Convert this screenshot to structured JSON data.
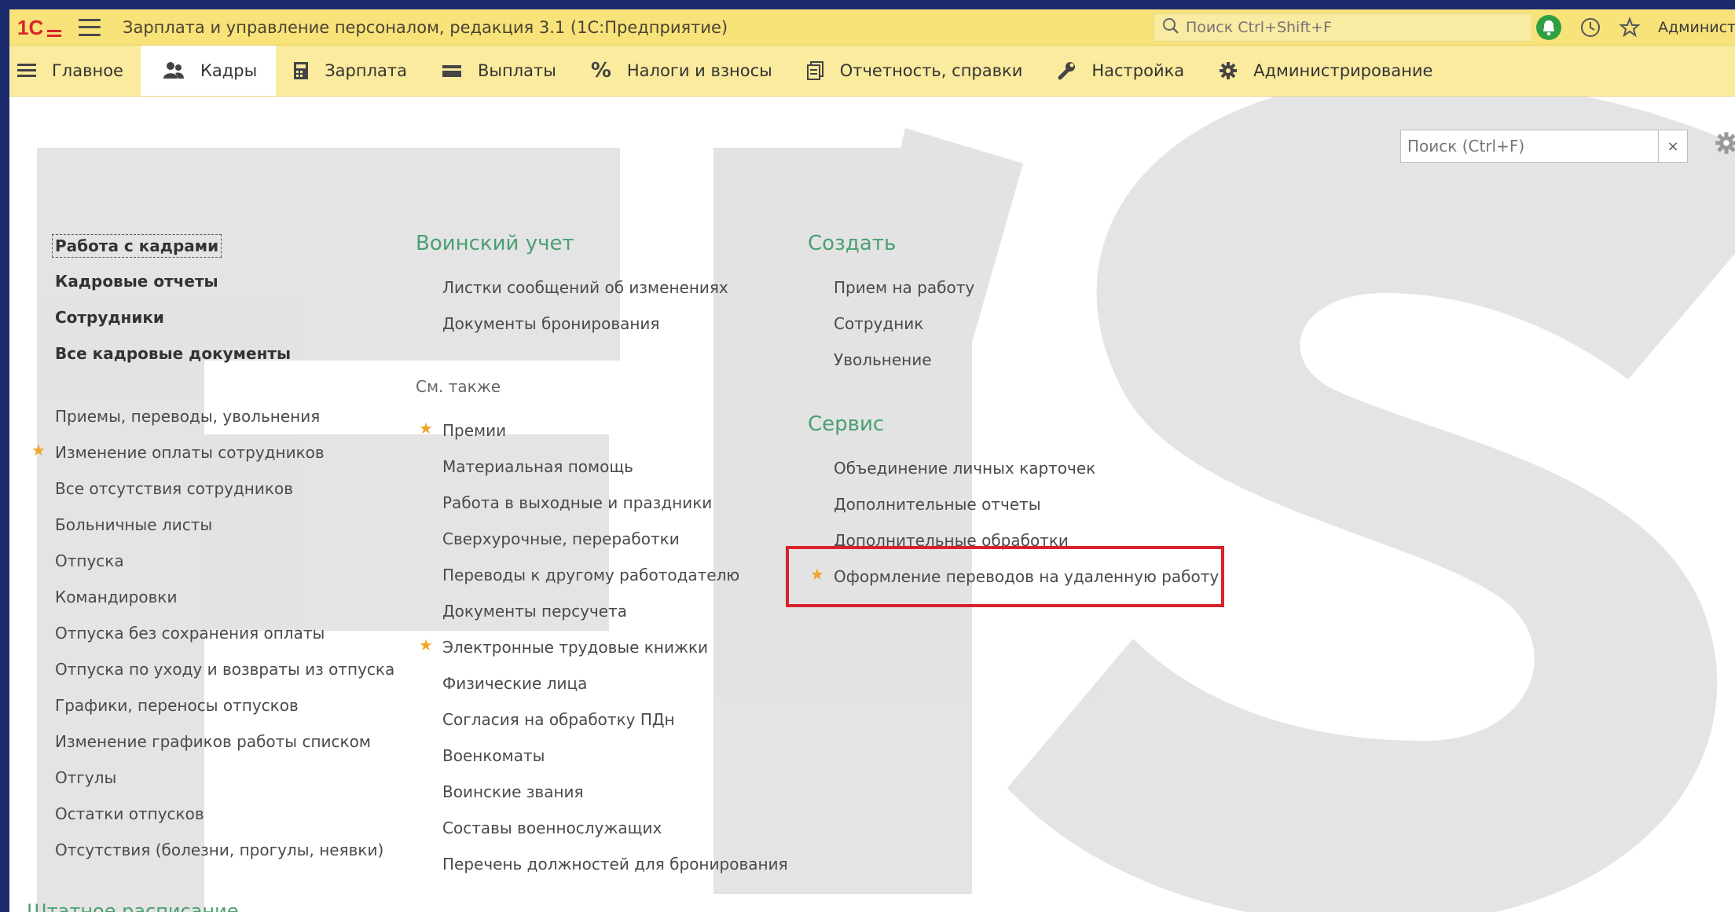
{
  "window": {
    "app_title": "Зарплата и управление персоналом, редакция 3.1  (1С:Предприятие)",
    "search_placeholder": "Поиск Ctrl+Shift+F",
    "user_name": "Админист"
  },
  "sections": [
    {
      "label": "Главное",
      "icon": "menu-icon"
    },
    {
      "label": "Кадры",
      "icon": "people-icon"
    },
    {
      "label": "Зарплата",
      "icon": "calculator-icon"
    },
    {
      "label": "Выплаты",
      "icon": "wallet-icon"
    },
    {
      "label": "Налоги и взносы",
      "icon": "percent-icon"
    },
    {
      "label": "Отчетность, справки",
      "icon": "report-icon"
    },
    {
      "label": "Настройка",
      "icon": "wrench-icon"
    },
    {
      "label": "Администрирование",
      "icon": "gear-icon"
    }
  ],
  "active_section": "Кадры",
  "local_search": {
    "placeholder": "Поиск (Ctrl+F)",
    "clear": "×"
  },
  "col1": {
    "bold_items": [
      "Работа с кадрами",
      "Кадровые отчеты",
      "Сотрудники",
      "Все кадровые документы"
    ],
    "items": [
      "Приемы, переводы, увольнения",
      "Изменение оплаты сотрудников",
      "Все отсутствия сотрудников",
      "Больничные листы",
      "Отпуска",
      "Командировки",
      "Отпуска без сохранения оплаты",
      "Отпуска по уходу и возвраты из отпуска",
      "Графики, переносы отпусков",
      "Изменение графиков работы списком",
      "Отгулы",
      "Остатки отпусков",
      "Отсутствия (болезни, прогулы, неявки)"
    ]
  },
  "col2": {
    "header": "Воинский учет",
    "group1": [
      "Листки сообщений об изменениях",
      "Документы бронирования"
    ],
    "see_also": "См. также",
    "group2": [
      "Премии",
      "Материальная помощь",
      "Работа в выходные и праздники",
      "Сверхурочные, переработки",
      "Переводы к другому работодателю",
      "Документы персучета",
      "Электронные трудовые книжки",
      "Физические лица",
      "Согласия на обработку ПДн",
      "Военкоматы",
      "Воинские звания",
      "Составы военнослужащих",
      "Перечень должностей для бронирования"
    ]
  },
  "col3": {
    "create_header": "Создать",
    "create_items": [
      "Прием на работу",
      "Сотрудник",
      "Увольнение"
    ],
    "service_header": "Сервис",
    "service_items": [
      "Объединение личных карточек",
      "Дополнительные отчеты",
      "Дополнительные обработки",
      "Оформление переводов на удаленную работу"
    ]
  },
  "footer_link": "Штатное расписание",
  "colors": {
    "title_bar": "#f8e27a",
    "section_bar": "#fbeb9e",
    "group_header": "#4aa071",
    "favorite_star": "#f0a52a",
    "highlight": "#d8232a",
    "outer_frame": "#1c2a6e"
  }
}
